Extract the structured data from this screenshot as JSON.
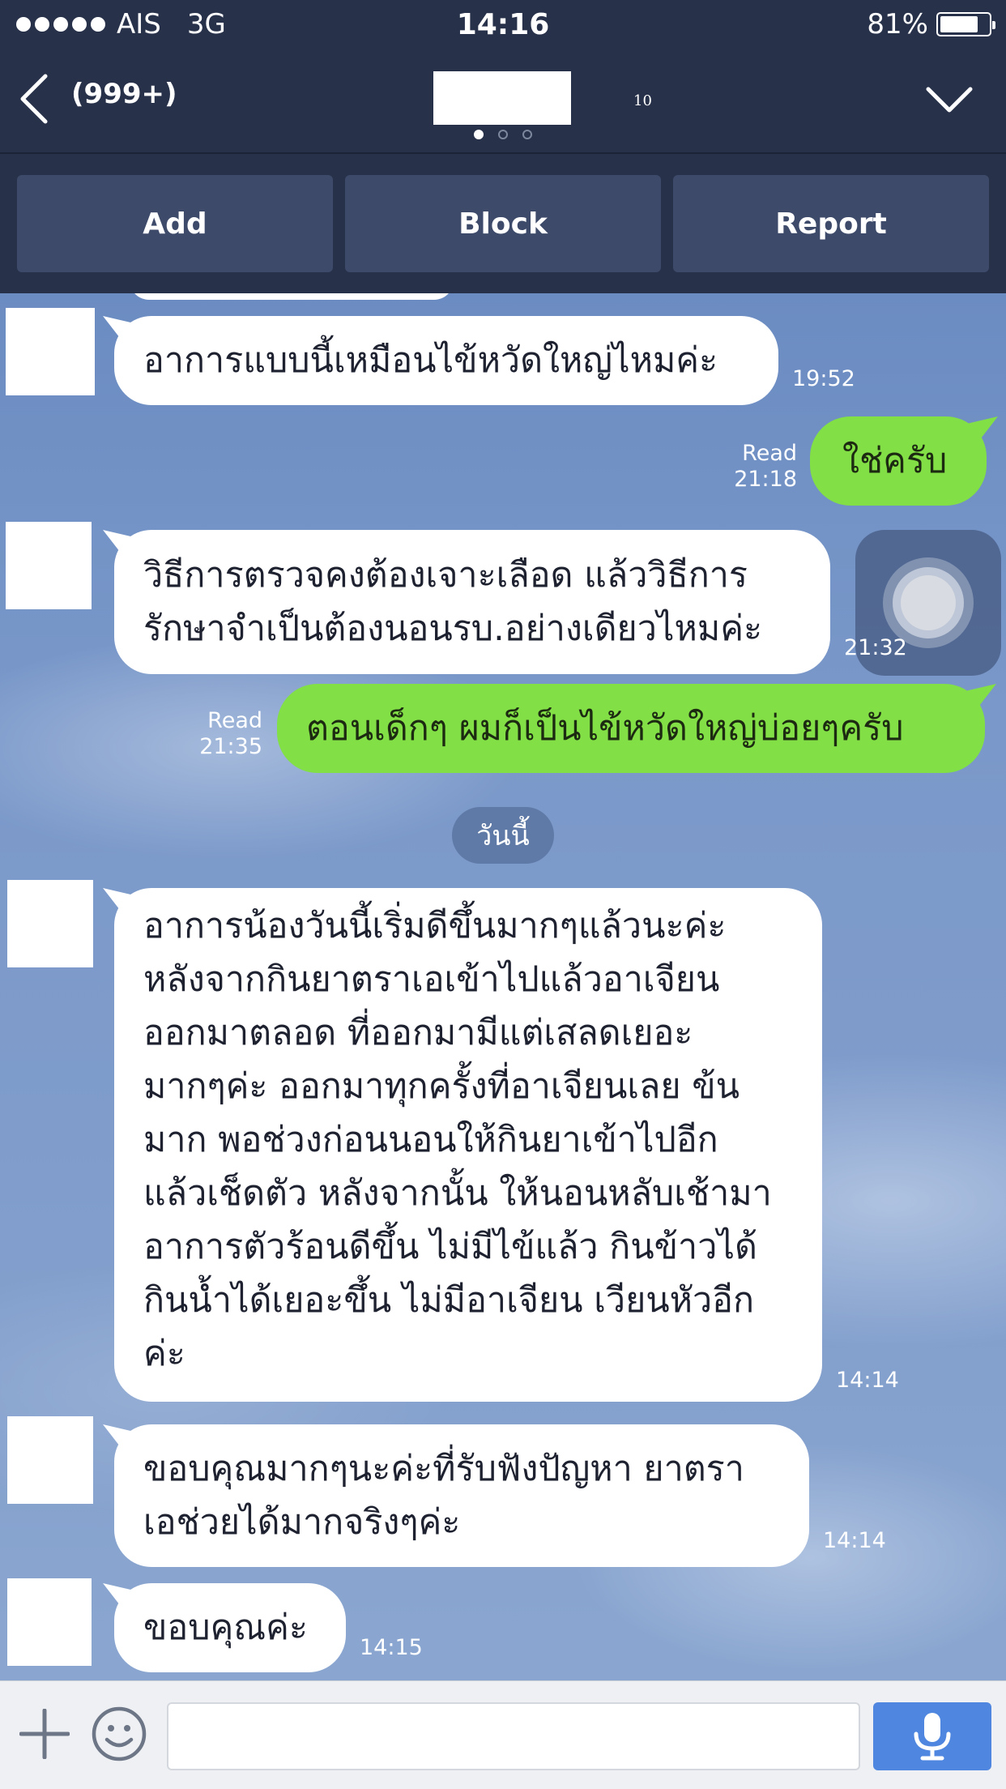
{
  "status_bar": {
    "carrier": "AIS",
    "network": "3G",
    "time": "14:16",
    "battery": "81%",
    "battery_level": 0.81
  },
  "nav": {
    "unread": "(999+)",
    "member_count": "10",
    "page_count": 3,
    "current_page": 1
  },
  "actions": {
    "add": "Add",
    "block": "Block",
    "report": "Report"
  },
  "messages": {
    "m1": {
      "lines": [
        "อาการแบบนี้เหมือนไข้หวัดใหญ่ไหมค่ะ"
      ],
      "time": "19:52"
    },
    "m2": {
      "lines": [
        "ใช่ครับ"
      ],
      "read": "Read",
      "time": "21:18"
    },
    "m3": {
      "lines": [
        "วิธีการตรวจคงต้องเจาะเลือด แล้ววิธีการ",
        "รักษาจำเป็นต้องนอนรบ.อย่างเดียวไหมค่ะ"
      ],
      "time": "21:32"
    },
    "m4": {
      "lines": [
        "ตอนเด็กๆ ผมก็เป็นไข้หวัดใหญ่บ่อยๆครับ"
      ],
      "read": "Read",
      "time": "21:35"
    },
    "m5": {
      "lines": [
        "อาการน้องวันนี้เริ่มดีขึ้นมากๆแล้วนะค่ะ",
        "หลังจากกินยาตราเอเข้าไปแล้วอาเจียน",
        "ออกมาตลอด ที่ออกมามีแต่เสลดเยอะ",
        "มากๆค่ะ ออกมาทุกครั้งที่อาเจียนเลย ข้น",
        "มาก พอช่วงก่อนนอนให้กินยาเข้าไปอีก",
        "แล้วเช็ดตัว หลังจากนั้น ให้นอนหลับเช้ามา",
        "อาการตัวร้อนดีขึ้น ไม่มีไข้แล้ว กินข้าวได้",
        "กินน้ำได้เยอะขึ้น ไม่มีอาเจียน เวียนหัวอีก",
        "ค่ะ"
      ],
      "time": "14:14"
    },
    "m6": {
      "lines": [
        "ขอบคุณมากๆนะค่ะที่รับฟังปัญหา ยาตรา",
        "เอช่วยได้มากจริงๆค่ะ"
      ],
      "time": "14:14"
    },
    "m7": {
      "lines": [
        "ขอบคุณค่ะ"
      ],
      "time": "14:15"
    }
  },
  "date_separator": "วันนี้",
  "input": {
    "value": "",
    "placeholder": ""
  },
  "colors": {
    "header": "#27314a",
    "button": "#3d4a6a",
    "sent_bubble": "#82df46",
    "mic": "#4f86e0"
  }
}
